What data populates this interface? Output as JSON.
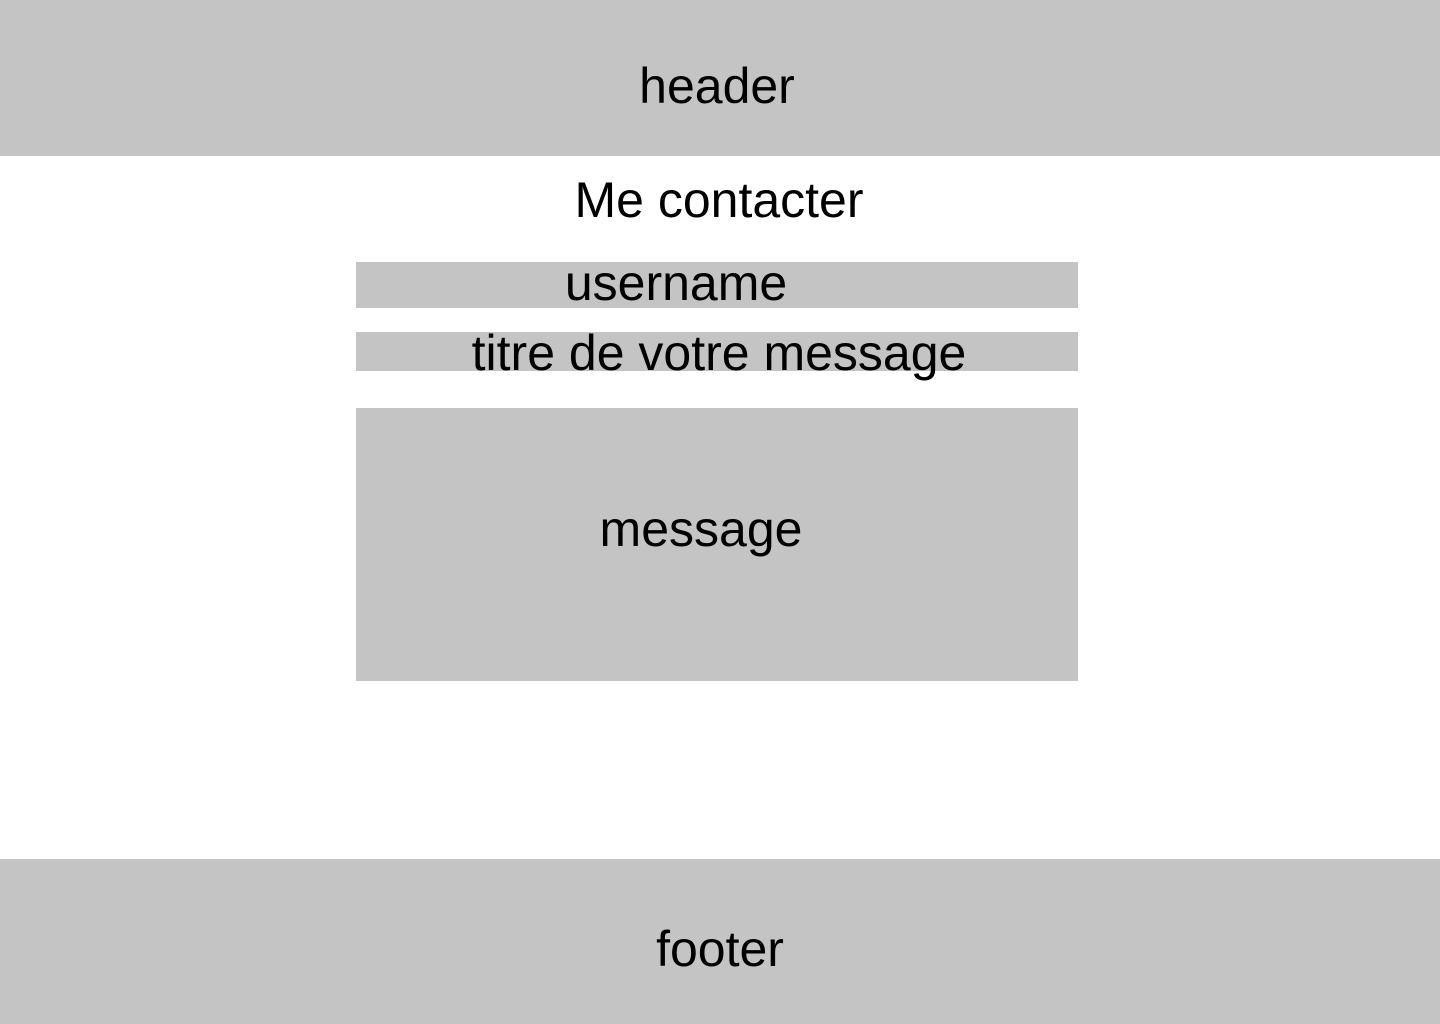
{
  "header": {
    "label": "header"
  },
  "page": {
    "title": "Me contacter"
  },
  "form": {
    "username_placeholder": "username",
    "subject_placeholder": "titre de votre message",
    "message_placeholder": "message"
  },
  "footer": {
    "label": "footer"
  },
  "colors": {
    "block_gray": "#c4c4c4",
    "background": "#ffffff",
    "text": "#000000"
  }
}
